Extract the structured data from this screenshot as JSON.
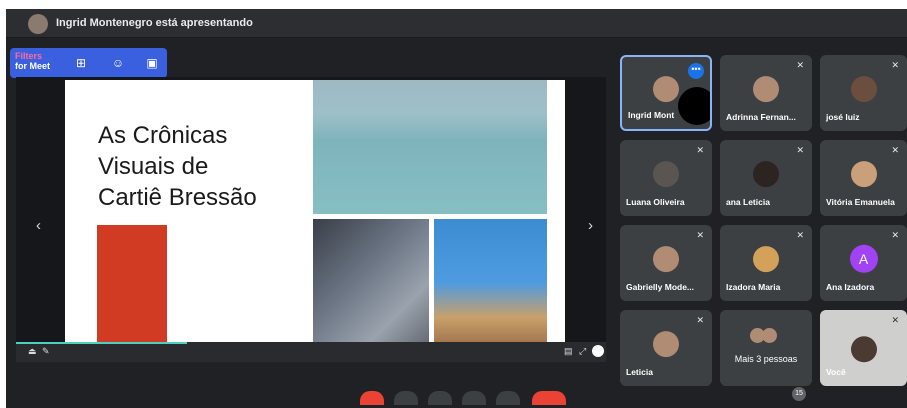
{
  "header": {
    "presenting_text": "Ingrid Montenegro está apresentando"
  },
  "filters": {
    "logo_line1": "Filters",
    "logo_line2": "for Meet"
  },
  "slide": {
    "title_lines": [
      "As Crônicas",
      "Visuais de",
      "Cartiê Bressão"
    ]
  },
  "presentation": {
    "progress": 0.29
  },
  "participants": [
    {
      "name": "Ingrid Mont",
      "muted": false,
      "active": true
    },
    {
      "name": "Adrinna Fernan...",
      "muted": true
    },
    {
      "name": "josé luiz",
      "muted": true
    },
    {
      "name": "Luana Oliveira",
      "muted": true
    },
    {
      "name": "ana Leticia",
      "muted": true
    },
    {
      "name": "Vitória Emanuela",
      "muted": true
    },
    {
      "name": "Gabrielly Mode...",
      "muted": true
    },
    {
      "name": "Izadora Maria",
      "muted": true
    },
    {
      "name": "Ana Izadora",
      "muted": true,
      "initial": "A"
    },
    {
      "name": "Leticia",
      "muted": true
    },
    {
      "name": "Mais 3 pessoas"
    },
    {
      "name": "Você",
      "muted": true
    }
  ],
  "participant_count": "15",
  "colors": {
    "accent": "#8ab4f8",
    "end_call": "#ea4335",
    "slide_red": "#d13b23"
  }
}
